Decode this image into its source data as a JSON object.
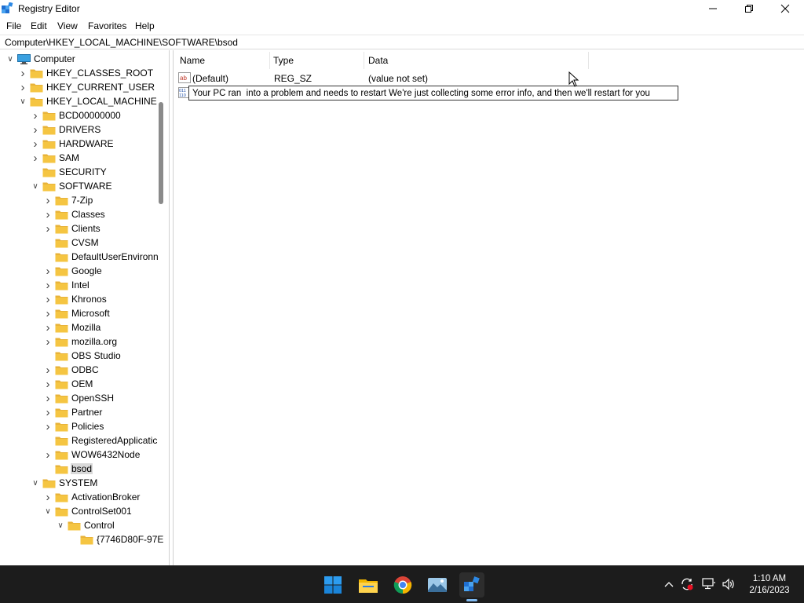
{
  "window": {
    "title": "Registry Editor",
    "minimize_icon": "minimize-icon",
    "maximize_icon": "restore-icon",
    "close_icon": "close-icon"
  },
  "menu": [
    "File",
    "Edit",
    "View",
    "Favorites",
    "Help"
  ],
  "address": "Computer\\HKEY_LOCAL_MACHINE\\SOFTWARE\\bsod",
  "tree": {
    "root": "Computer",
    "items": [
      {
        "label": "HKEY_CLASSES_ROOT",
        "level": 1,
        "expander": "collapsed"
      },
      {
        "label": "HKEY_CURRENT_USER",
        "level": 1,
        "expander": "collapsed"
      },
      {
        "label": "HKEY_LOCAL_MACHINE",
        "level": 1,
        "expander": "expanded"
      },
      {
        "label": "BCD00000000",
        "level": 2,
        "expander": "collapsed"
      },
      {
        "label": "DRIVERS",
        "level": 2,
        "expander": "collapsed"
      },
      {
        "label": "HARDWARE",
        "level": 2,
        "expander": "collapsed"
      },
      {
        "label": "SAM",
        "level": 2,
        "expander": "collapsed"
      },
      {
        "label": "SECURITY",
        "level": 2,
        "expander": "none"
      },
      {
        "label": "SOFTWARE",
        "level": 2,
        "expander": "expanded"
      },
      {
        "label": "7-Zip",
        "level": 3,
        "expander": "collapsed"
      },
      {
        "label": "Classes",
        "level": 3,
        "expander": "collapsed"
      },
      {
        "label": "Clients",
        "level": 3,
        "expander": "collapsed"
      },
      {
        "label": "CVSM",
        "level": 3,
        "expander": "none"
      },
      {
        "label": "DefaultUserEnvironn",
        "level": 3,
        "expander": "none"
      },
      {
        "label": "Google",
        "level": 3,
        "expander": "collapsed"
      },
      {
        "label": "Intel",
        "level": 3,
        "expander": "collapsed"
      },
      {
        "label": "Khronos",
        "level": 3,
        "expander": "collapsed"
      },
      {
        "label": "Microsoft",
        "level": 3,
        "expander": "collapsed"
      },
      {
        "label": "Mozilla",
        "level": 3,
        "expander": "collapsed"
      },
      {
        "label": "mozilla.org",
        "level": 3,
        "expander": "collapsed"
      },
      {
        "label": "OBS Studio",
        "level": 3,
        "expander": "none"
      },
      {
        "label": "ODBC",
        "level": 3,
        "expander": "collapsed"
      },
      {
        "label": "OEM",
        "level": 3,
        "expander": "collapsed"
      },
      {
        "label": "OpenSSH",
        "level": 3,
        "expander": "collapsed"
      },
      {
        "label": "Partner",
        "level": 3,
        "expander": "collapsed"
      },
      {
        "label": "Policies",
        "level": 3,
        "expander": "collapsed"
      },
      {
        "label": "RegisteredApplicatic",
        "level": 3,
        "expander": "none"
      },
      {
        "label": "WOW6432Node",
        "level": 3,
        "expander": "collapsed"
      },
      {
        "label": "bsod",
        "level": 3,
        "expander": "none",
        "selected": true
      },
      {
        "label": "SYSTEM",
        "level": 2,
        "expander": "expanded"
      },
      {
        "label": "ActivationBroker",
        "level": 3,
        "expander": "collapsed"
      },
      {
        "label": "ControlSet001",
        "level": 3,
        "expander": "expanded"
      },
      {
        "label": "Control",
        "level": 4,
        "expander": "expanded"
      },
      {
        "label": "{7746D80F-97E",
        "level": 5,
        "expander": "none"
      }
    ]
  },
  "list": {
    "columns": [
      "Name",
      "Type",
      "Data"
    ],
    "rows": [
      {
        "name": "(Default)",
        "type": "REG_SZ",
        "data": "(value not set)",
        "icon": "string-value-icon"
      }
    ],
    "editing": {
      "icon": "binary-value-icon",
      "value": "Your PC ran  into a problem and needs to restart We're just collecting some error info, and then we'll restart for you"
    }
  },
  "taskbar": {
    "apps": [
      "start-icon",
      "file-explorer-icon",
      "chrome-icon",
      "photos-icon",
      "registry-editor-icon"
    ],
    "tray": [
      "chevron-up-icon",
      "sync-icon",
      "network-icon",
      "volume-icon"
    ],
    "time": "1:10 AM",
    "date": "2/16/2023"
  },
  "colors": {
    "folder": "#f5c542",
    "taskbar": "#1c1c1c",
    "accent": "#0078d4"
  }
}
